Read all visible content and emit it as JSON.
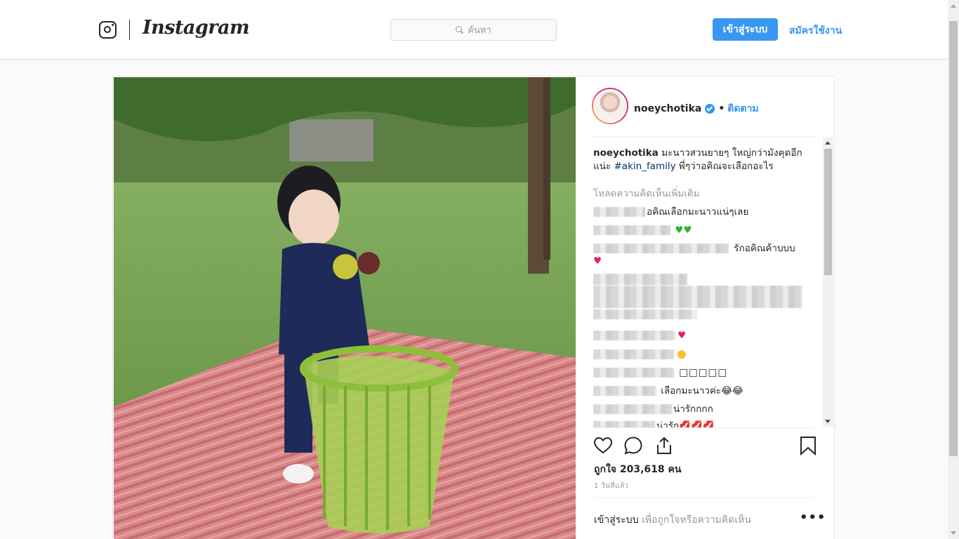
{
  "header": {
    "brand": "Instagram",
    "search_placeholder": "ค้นหา",
    "login_label": "เข้าสู่ระบบ",
    "signup_label": "สมัครใช้งาน"
  },
  "post": {
    "username": "noeychotika",
    "follow_label": "ติดตาม",
    "separator": "•",
    "caption_user": "noeychotika",
    "caption_text_1": " มะนาวสวนยายๆ ใหญ่กว่ามังคุดอีกแน่ะ ",
    "caption_hashtag": "#akin_family",
    "caption_text_2": " พี่ๆว่าอคิณจะเลือกอะไร",
    "load_more": "โหลดความคิดเห็นเพิ่มเติม",
    "comments": [
      {
        "text": "อคิณเลือกมะนาวแน่ๆเลย"
      },
      {
        "text": ""
      },
      {
        "text": " รักอคิณค้าบบบ"
      },
      {
        "text": ""
      },
      {
        "text": ""
      },
      {
        "text": ""
      },
      {
        "text": ""
      },
      {
        "text": "□□□□□"
      },
      {
        "text": " เลือกมะนาวค่ะ😂😂"
      },
      {
        "text": "น่ารักกกก"
      },
      {
        "text": "น่ารัก💋💋💋"
      }
    ],
    "likes": "ถูกใจ 203,618 คน",
    "time_ago": "1 วันที่แล้ว",
    "footer_login": "เข้าสู่ระบบ",
    "footer_text": " เพื่อถูกใจหรือความคิดเห็น",
    "more_label": "•••"
  },
  "icons": [
    "instagram-glyph-icon",
    "search-icon",
    "verified-badge-icon",
    "heart-icon",
    "comment-icon",
    "share-icon",
    "bookmark-icon",
    "more-options-icon"
  ],
  "colors": {
    "accent": "#3897f0",
    "hashtag": "#003569",
    "muted": "#999999",
    "text": "#262626"
  }
}
